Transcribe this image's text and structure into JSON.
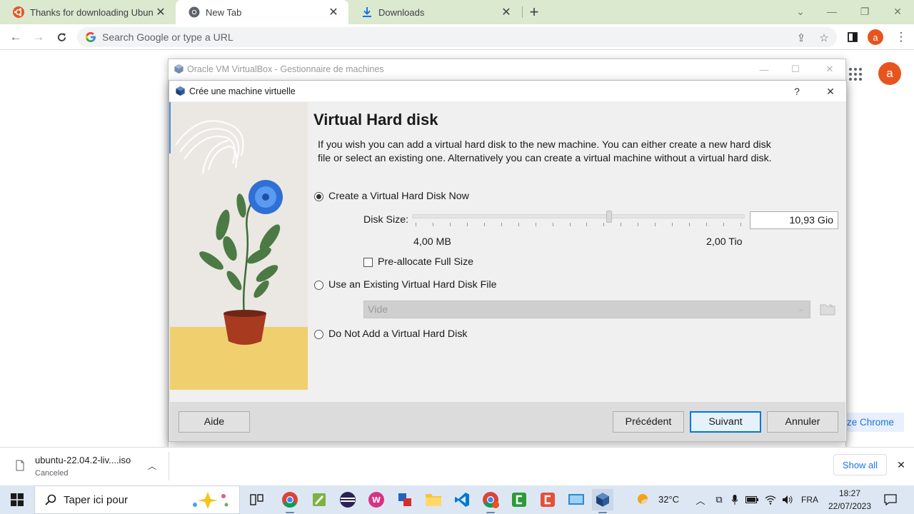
{
  "browser": {
    "tabs": [
      {
        "title": "Thanks for downloading Ubuntu"
      },
      {
        "title": "New Tab"
      },
      {
        "title": "Downloads"
      }
    ],
    "omnibox_placeholder": "Search Google or type a URL",
    "profile_initial": "a",
    "customize_label": "ze Chrome"
  },
  "vbox_manager": {
    "title": "Oracle VM VirtualBox - Gestionnaire de machines"
  },
  "wizard": {
    "title": "Crée une machine virtuelle",
    "help_glyph": "?",
    "heading": "Virtual Hard disk",
    "description": "If you wish you can add a virtual hard disk to the new machine. You can either create a new hard disk file or select an existing one. Alternatively you can create a virtual machine without a virtual hard disk.",
    "options": {
      "create_now": "Create a Virtual Hard Disk Now",
      "use_existing": "Use an Existing Virtual Hard Disk File",
      "do_not_add": "Do Not Add a Virtual Hard Disk"
    },
    "selected_option": "create_now",
    "disk_size": {
      "label": "Disk Size:",
      "value": "10,93 Gio",
      "min_label": "4,00 MB",
      "max_label": "2,00 Tio"
    },
    "preallocate_label": "Pre-allocate Full Size",
    "preallocate_checked": false,
    "existing_file_select": "Vide",
    "buttons": {
      "help": "Aide",
      "back": "Précédent",
      "next": "Suivant",
      "cancel": "Annuler"
    }
  },
  "download_bar": {
    "file_name": "ubuntu-22.04.2-liv....iso",
    "status": "Canceled",
    "show_all": "Show all"
  },
  "taskbar": {
    "search_placeholder": "Taper ici pour",
    "temperature": "32°C",
    "language": "FRA",
    "time": "18:27",
    "date": "22/07/2023"
  },
  "colors": {
    "tab_strip": "#dbe9cf",
    "accent_orange": "#e8541e",
    "chrome_blue": "#1a73e8",
    "vbox_default_button": "#0078d7",
    "taskbar": "#dde7f3"
  },
  "icons": [
    "ubuntu-icon",
    "chrome-icon",
    "download-icon",
    "google-g-icon",
    "share-icon",
    "star-icon",
    "sidebar-icon",
    "apps-grid-icon",
    "virtualbox-icon",
    "folder-icon",
    "windows-start-icon",
    "search-icon"
  ]
}
